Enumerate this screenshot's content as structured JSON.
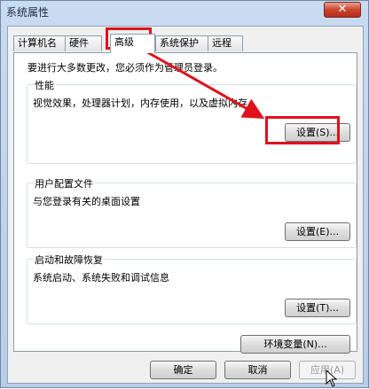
{
  "window": {
    "title": "系统属性",
    "close_label": "✕"
  },
  "tabs": [
    {
      "label": "计算机名",
      "active": false
    },
    {
      "label": "硬件",
      "active": false
    },
    {
      "label": "高级",
      "active": true
    },
    {
      "label": "系统保护",
      "active": false
    },
    {
      "label": "远程",
      "active": false
    }
  ],
  "admin_note": "要进行大多数更改，您必须作为管理员登录。",
  "groups": {
    "performance": {
      "title": "性能",
      "desc": "视觉效果，处理器计划，内存使用，以及虚拟内存",
      "button": "设置(S)..."
    },
    "profile": {
      "title": "用户配置文件",
      "desc": "与您登录有关的桌面设置",
      "button": "设置(E)..."
    },
    "startup": {
      "title": "启动和故障恢复",
      "desc": "系统启动、系统失败和调试信息",
      "button": "设置(T)..."
    }
  },
  "env_button": "环境变量(N)...",
  "footer": {
    "ok": "确定",
    "cancel": "取消",
    "apply": "应用(A)"
  },
  "colors": {
    "highlight": "#e0111b",
    "accent": "#c9452e"
  },
  "icons": {
    "close": "close-icon",
    "cursor": "mouse-pointer-icon"
  }
}
